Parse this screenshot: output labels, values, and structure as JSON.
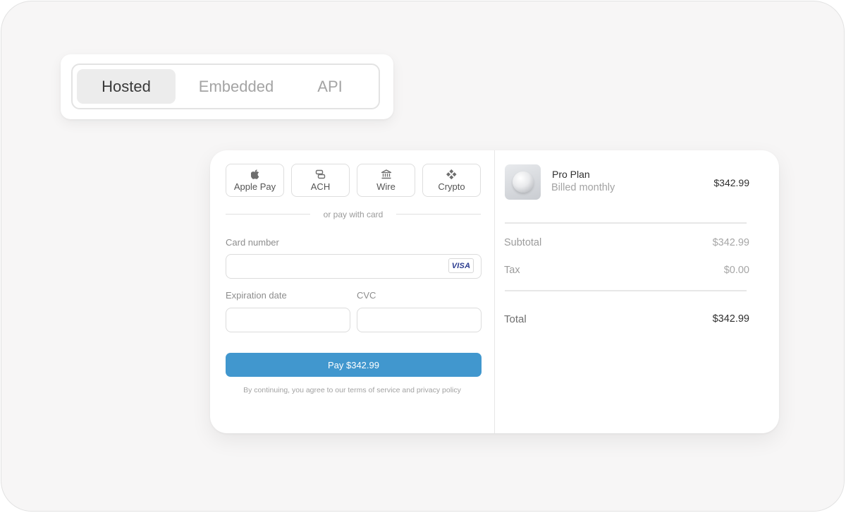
{
  "integration_tabs": {
    "items": [
      {
        "label": "Hosted",
        "active": true
      },
      {
        "label": "Embedded",
        "active": false
      },
      {
        "label": "API",
        "active": false
      }
    ]
  },
  "payment_methods": [
    {
      "label": "Apple Pay",
      "icon": "apple-icon"
    },
    {
      "label": "ACH",
      "icon": "bank-transfer-icon"
    },
    {
      "label": "Wire",
      "icon": "bank-building-icon"
    },
    {
      "label": "Crypto",
      "icon": "crypto-icon"
    }
  ],
  "divider_text": "or pay with card",
  "card_form": {
    "card_number_label": "Card number",
    "card_number_value": "",
    "card_brand": "VISA",
    "expiration_label": "Expiration date",
    "expiration_value": "",
    "cvc_label": "CVC",
    "cvc_value": ""
  },
  "pay_button_label": "Pay $342.99",
  "terms_text": "By continuing, you agree to our terms of service and privacy policy",
  "order_summary": {
    "product_name": "Pro Plan",
    "product_billing": "Billed monthly",
    "product_price": "$342.99",
    "subtotal_label": "Subtotal",
    "subtotal_value": "$342.99",
    "tax_label": "Tax",
    "tax_value": "$0.00",
    "total_label": "Total",
    "total_value": "$342.99"
  },
  "colors": {
    "accent": "#4197ce",
    "background": "#f7f6f6",
    "card": "#ffffff",
    "active_tab": "#ececec"
  }
}
